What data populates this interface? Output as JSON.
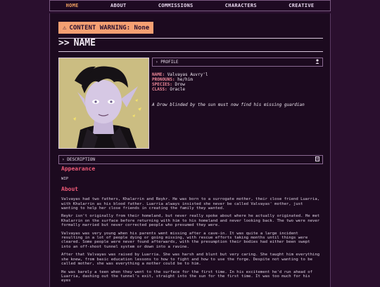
{
  "nav": {
    "items": [
      {
        "label": "HOME",
        "active": true
      },
      {
        "label": "ABOUT",
        "active": false
      },
      {
        "label": "COMMISSIONS",
        "active": false
      },
      {
        "label": "CHARACTERS",
        "active": false
      },
      {
        "label": "CREATIVE",
        "active": false
      }
    ]
  },
  "content_warning": {
    "icon": "warning-icon",
    "glyph": "⚠",
    "label": "CONTENT WARNING: None"
  },
  "name_section": {
    "arrows": ">>",
    "title": "NAME"
  },
  "profile": {
    "header_label": "PROFILE",
    "rows": [
      {
        "key": "NAME:",
        "value": "Valvayas Auvry'l"
      },
      {
        "key": "PRONOUNS:",
        "value": "he/him"
      },
      {
        "key": "SPECIES:",
        "value": "Drow"
      },
      {
        "key": "CLASS:",
        "value": "Oracle"
      }
    ],
    "tagline": "A Drow blinded by the sun must now find his missing guardian"
  },
  "description": {
    "header_label": "DESCRIPTION",
    "appearance_heading": "Appearance",
    "appearance_text": "WIP",
    "about_heading": "About",
    "paragraphs": [
      "Valvayas had two fathers, Khalarrin and Reykr. He was born to a surrogate mother, their close friend Luarria, with Khalarrin as his blood father. Luarria always insisted she never be called Valvayas' mother, just wanting to help her close friends in creating the family they wanted.",
      "Reykr isn't originally from their homeland, but never really spoke about where he actually originated. He met Khalarrin on the surface before returning with him to his homeland and never looking back. The two were never formally married but never corrected people who presumed they were.",
      "Valvayas was very young when his parents went missing after a cave-in. It was quite a large incident resulting in a lot of people dying or going missing, with rescue efforts taking months until things were cleared. Some people were never found afterwards, with the presumption their bodies had either been swept into an off-shoot tunnel system or down into a ravine.",
      "After that Valvayas was raised by Luarria. She was harsh and blunt but very caring. She taught him everything she knew, from basic education lessons to how to fight and how to use the forge. Despite not wanting to be called mother, she was everything a mother could be to him.",
      "He was barely a teen when they went to the surface for the first time. In his excitement he'd run ahead of Luarria, dashing out the tunnel's exit, straight into the sun for the first time. It was too much for his eyes"
    ]
  },
  "colors": {
    "accent": "#f05a78",
    "warning_bg": "#f5a072",
    "nav_active": "#f0a060",
    "background": "#2a0f2e"
  }
}
